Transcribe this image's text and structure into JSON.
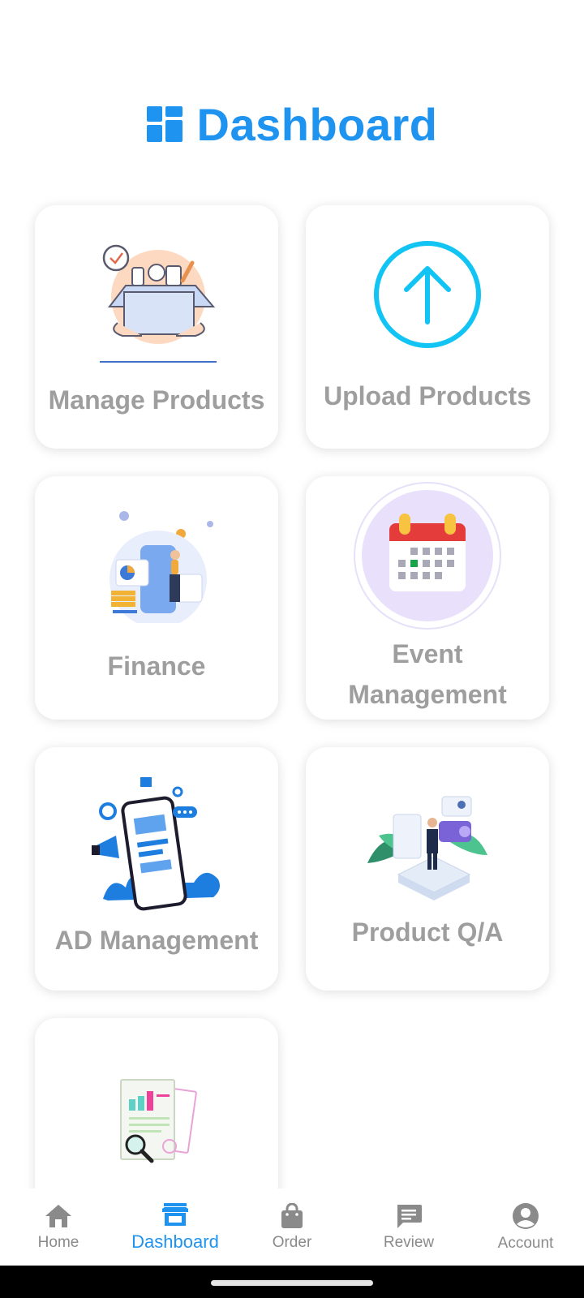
{
  "header": {
    "title": "Dashboard",
    "icon": "dashboard-icon",
    "color": "#1f93f0"
  },
  "cards": [
    {
      "label": "Manage Products",
      "icon": "box-of-products-illustration"
    },
    {
      "label": "Upload Products",
      "icon": "upload-arrow-circle-icon"
    },
    {
      "label": "Finance",
      "icon": "finance-illustration"
    },
    {
      "label": "Event Management",
      "icon": "calendar-icon"
    },
    {
      "label": "AD Management",
      "icon": "phone-advertising-illustration"
    },
    {
      "label": "Product Q/A",
      "icon": "product-qa-illustration"
    },
    {
      "label": "",
      "icon": "report-analysis-illustration"
    }
  ],
  "bottom_nav": {
    "items": [
      {
        "label": "Home",
        "icon": "home-icon",
        "active": false
      },
      {
        "label": "Dashboard",
        "icon": "store-icon",
        "active": true
      },
      {
        "label": "Order",
        "icon": "shopping-bag-icon",
        "active": false
      },
      {
        "label": "Review",
        "icon": "chat-bubble-icon",
        "active": false
      },
      {
        "label": "Account",
        "icon": "account-circle-icon",
        "active": false
      }
    ],
    "active_color": "#1f93f0",
    "inactive_color": "#8a8a8a"
  }
}
